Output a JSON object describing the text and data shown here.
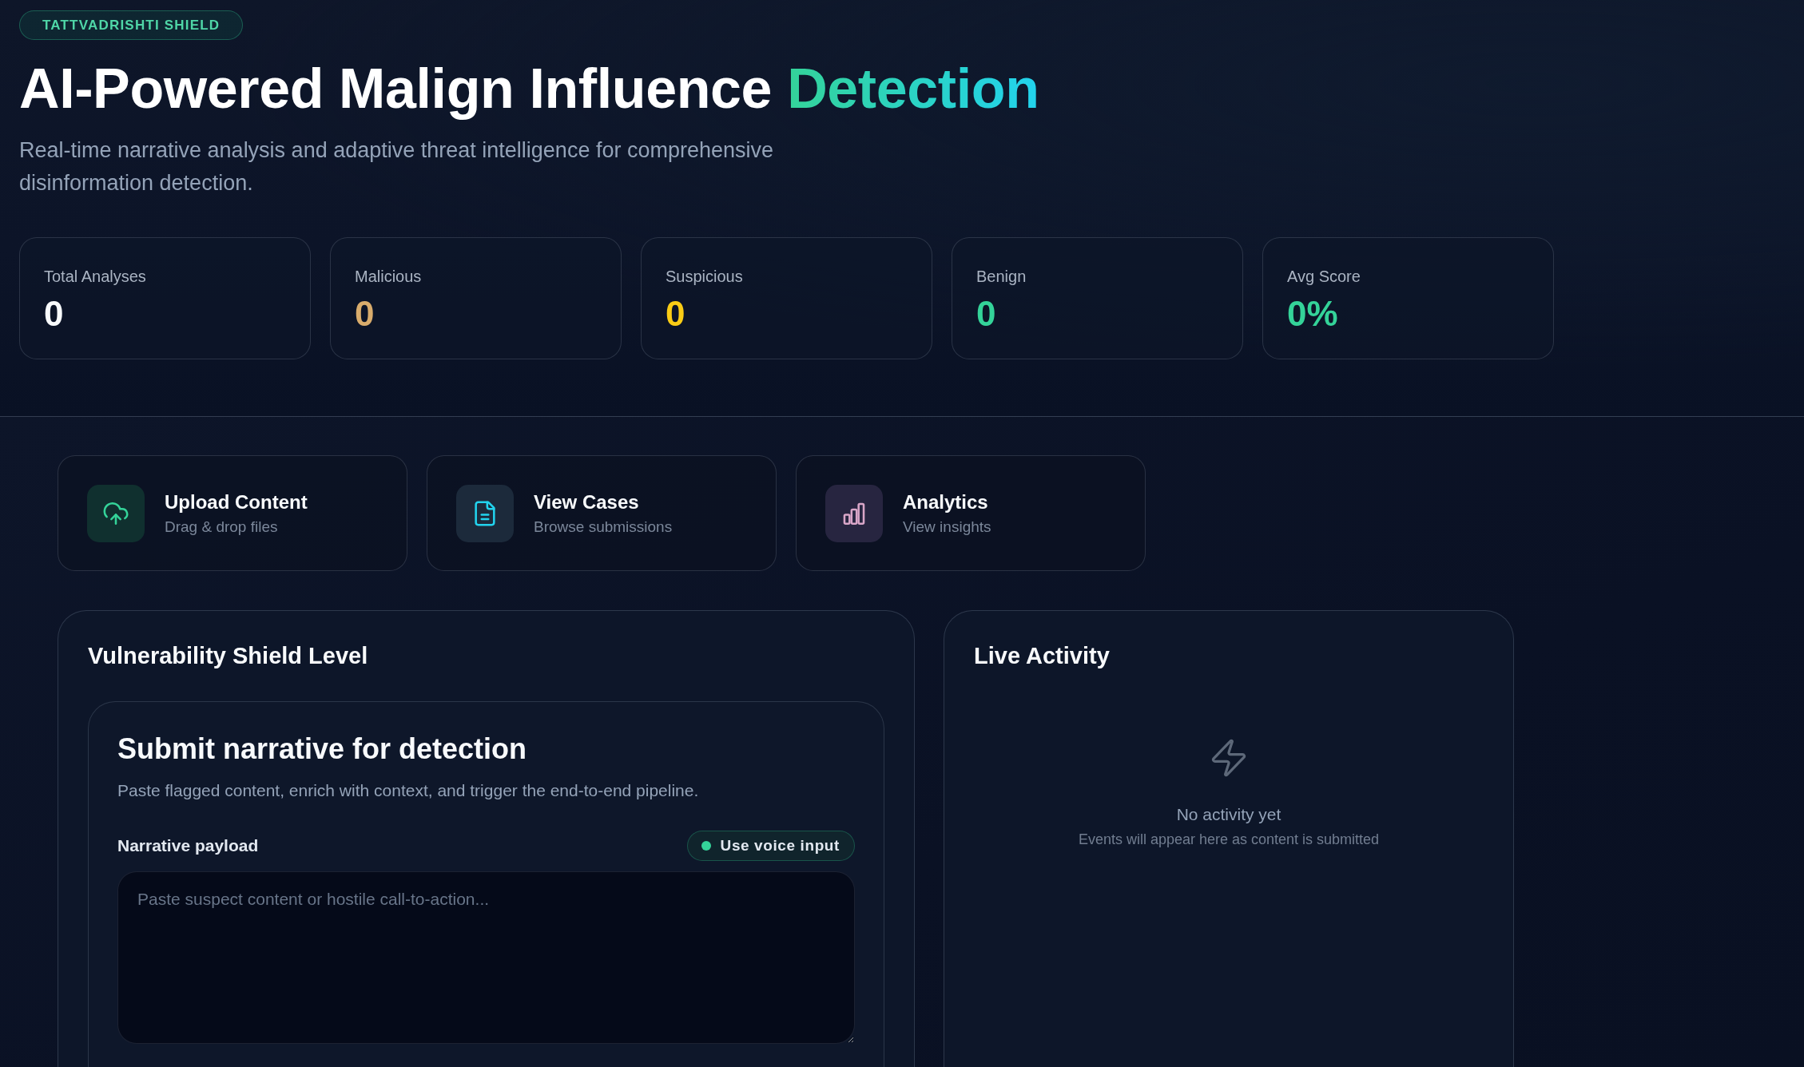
{
  "header": {
    "badge": "TATTVADRISHTI SHIELD",
    "title": "AI-Powered Malign Influence",
    "title_highlight": "Detection",
    "subtitle": "Real-time narrative analysis and adaptive threat intelligence for comprehensive disinformation detection."
  },
  "stats": [
    {
      "label": "Total Analyses",
      "value": "0",
      "color": "#f8fafc"
    },
    {
      "label": "Malicious",
      "value": "0",
      "color": "#d9ac6c"
    },
    {
      "label": "Suspicious",
      "value": "0",
      "color": "#facc15"
    },
    {
      "label": "Benign",
      "value": "0",
      "color": "#34d399"
    },
    {
      "label": "Avg Score",
      "value": "0%",
      "color": "#34d399"
    }
  ],
  "actions": [
    {
      "kind": "upload",
      "title": "Upload Content",
      "subtitle": "Drag & drop files"
    },
    {
      "kind": "cases",
      "title": "View Cases",
      "subtitle": "Browse submissions"
    },
    {
      "kind": "analytics",
      "title": "Analytics",
      "subtitle": "View insights"
    }
  ],
  "shield_panel": {
    "title": "Vulnerability Shield Level",
    "form": {
      "title": "Submit narrative for detection",
      "description": "Paste flagged content, enrich with context, and trigger the end-to-end pipeline.",
      "field_label": "Narrative payload",
      "voice_button": "Use voice input",
      "placeholder": "Paste suspect content or hostile call-to-action..."
    }
  },
  "activity_panel": {
    "title": "Live Activity",
    "empty_title": "No activity yet",
    "empty_text": "Events will appear here as content is submitted"
  }
}
